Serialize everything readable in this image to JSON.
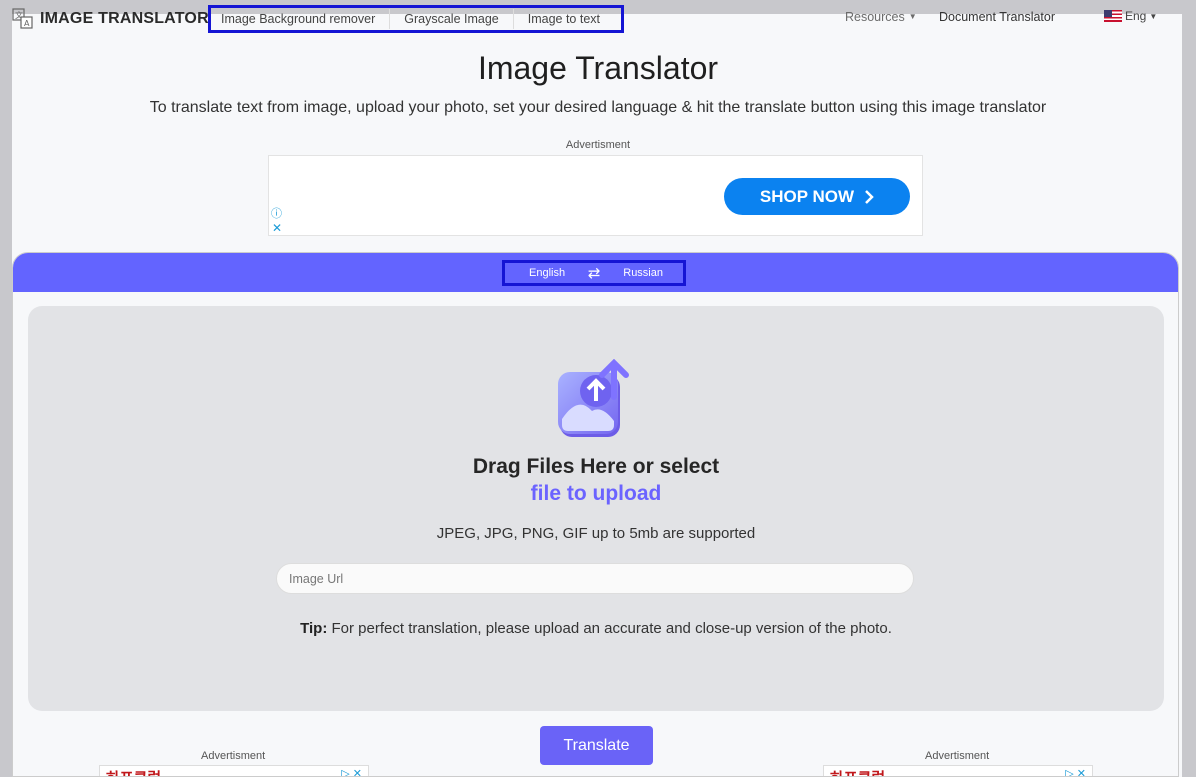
{
  "header": {
    "logo_text": "IMAGE TRANSLATOR",
    "nav": [
      "Image Background remover",
      "Grayscale Image",
      "Image to text"
    ],
    "resources_label": "Resources",
    "doc_translator_label": "Document Translator",
    "language_label": "Eng"
  },
  "hero": {
    "title": "Image Translator",
    "subtitle": "To translate text from image, upload your photo, set your desired language & hit the translate button using this image translator"
  },
  "ad": {
    "label": "Advertisment",
    "cta": "SHOP NOW",
    "cta_color": "#0b82f0"
  },
  "translator": {
    "bar_color": "#6364ff",
    "source_language": "English",
    "target_language": "Russian",
    "drag_text": "Drag Files Here or select",
    "upload_link": "file to upload",
    "formats": "JPEG, JPG, PNG, GIF up to 5mb are supported",
    "url_placeholder": "Image Url",
    "tip_label": "Tip:",
    "tip_text": " For perfect translation, please upload an accurate and close-up version of the photo.",
    "translate_button": "Translate",
    "button_color": "#6a63f7"
  },
  "bottom_ads": {
    "left_label": "Advertisment",
    "right_label": "Advertisment",
    "left_text": "하프클럽",
    "right_text": "하프클럽"
  }
}
